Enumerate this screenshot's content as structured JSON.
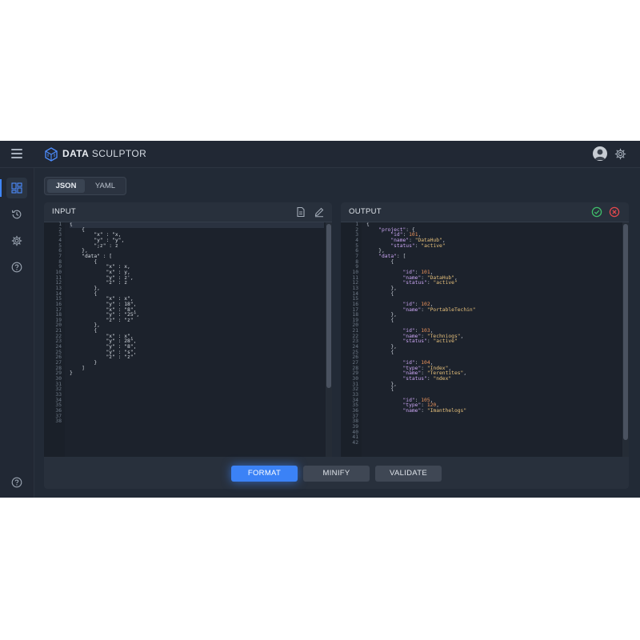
{
  "app": {
    "brand_bold": "DATA",
    "brand_light": "SCULPTOR"
  },
  "mode_tabs": [
    {
      "label": "JSON",
      "active": true
    },
    {
      "label": "YAML",
      "active": false
    }
  ],
  "input_panel": {
    "title": "INPUT",
    "lines": [
      "{",
      "    {",
      "        \"x\" : \"x,",
      "        \"y\" : \"y\",",
      "        \";z\" : z",
      "    },",
      "    \"data\" : [",
      "        {",
      "            \"x\" : x,",
      "            \"x\" : y,",
      "            \"y\" : z',",
      "            \"z\" : z",
      "        },",
      "        {",
      "            \"x\" : x\",",
      "            \"y\" : 18\",",
      "            \"x\" : \"8\",",
      "            \"y\" : \"25\",",
      "            \"z\" : \"z\"",
      "        },",
      "        {",
      "            \"x\" : x\",",
      "            \"y\" : 28\",",
      "            \"y\" : \"8\",",
      "            \"y\" : \"s\",",
      "            \"z\" : \"z\"",
      "        }",
      "    ]",
      "}",
      ""
    ],
    "line_numbers": [
      "1",
      "2",
      "3",
      "4",
      "5",
      "6",
      "7",
      "8",
      "9",
      "10",
      "11",
      "12",
      "13",
      "14",
      "15",
      "16",
      "17",
      "18",
      "19",
      "20",
      "21",
      "22",
      "23",
      "24",
      "25",
      "26",
      "27",
      "28",
      "29",
      "30",
      "31",
      "32",
      "33",
      "34",
      "35",
      "36",
      "37",
      "38"
    ]
  },
  "output_panel": {
    "title": "OUTPUT",
    "line_numbers": [
      "1",
      "2",
      "3",
      "4",
      "5",
      "6",
      "7",
      "8",
      "9",
      "10",
      "11",
      "12",
      "13",
      "14",
      "15",
      "16",
      "17",
      "18",
      "19",
      "20",
      "21",
      "22",
      "23",
      "24",
      "25",
      "26",
      "27",
      "28",
      "29",
      "30",
      "31",
      "32",
      "33",
      "34",
      "35",
      "36",
      "37",
      "38",
      "39",
      "40",
      "41",
      "42"
    ]
  },
  "footer": {
    "format_label": "FORMAT",
    "minify_label": "MINIFY",
    "validate_label": "VALIDATE"
  },
  "icons": {
    "menu": "hamburger-menu-icon",
    "logo": "cube-logo-icon",
    "avatar": "user-avatar-icon",
    "settings": "gear-icon",
    "dashboard": "dashboard-icon",
    "history": "history-icon",
    "help": "help-circle-icon",
    "file": "document-icon",
    "edit": "pencil-icon",
    "valid": "check-circle-icon",
    "clear": "close-circle-icon"
  },
  "colors": {
    "accent": "#3b82f6",
    "valid": "#3fbf6a",
    "error": "#e5484d",
    "key": "#c8a4f0",
    "string": "#e6c07b",
    "number": "#e8925b"
  }
}
